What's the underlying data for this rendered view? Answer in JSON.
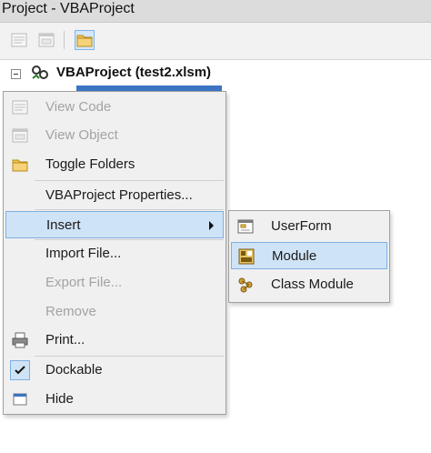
{
  "window": {
    "title": "Project - VBAProject"
  },
  "toolbar": {
    "buttons": [
      {
        "name": "view-code",
        "icon": "code-window-icon",
        "state": "disabled"
      },
      {
        "name": "view-object",
        "icon": "form-window-icon",
        "state": "disabled"
      },
      {
        "name": "toggle-folders",
        "icon": "folder-icon",
        "state": "pressed"
      }
    ]
  },
  "tree": {
    "project_label": "VBAProject (test2.xlsm)",
    "project_icon": "vba-project-icon",
    "expander_icon": "collapse-minus-icon"
  },
  "context_menu": {
    "items": [
      {
        "label": "View Code",
        "enabled": false,
        "icon": "code-window-icon"
      },
      {
        "label": "View Object",
        "enabled": false,
        "icon": "form-window-icon"
      },
      {
        "label": "Toggle Folders",
        "enabled": true,
        "icon": "folder-icon"
      },
      {
        "label": "VBAProject Properties...",
        "enabled": true,
        "icon": ""
      },
      {
        "label": "Insert",
        "enabled": true,
        "icon": "",
        "has_submenu": true,
        "highlighted": true
      },
      {
        "label": "Import File...",
        "enabled": true,
        "icon": ""
      },
      {
        "label": "Export File...",
        "enabled": false,
        "icon": ""
      },
      {
        "label": "Remove",
        "enabled": false,
        "icon": ""
      },
      {
        "label": "Print...",
        "enabled": true,
        "icon": "printer-icon"
      },
      {
        "label": "Dockable",
        "enabled": true,
        "icon": "checkmark-icon",
        "checked": true
      },
      {
        "label": "Hide",
        "enabled": true,
        "icon": "hide-window-icon"
      }
    ]
  },
  "insert_submenu": {
    "items": [
      {
        "label": "UserForm",
        "icon": "userform-icon"
      },
      {
        "label": "Module",
        "icon": "module-icon",
        "highlighted": true
      },
      {
        "label": "Class Module",
        "icon": "class-module-icon"
      }
    ]
  },
  "colors": {
    "menu_bg": "#f0f0f0",
    "highlight_bg": "#cfe3f6",
    "highlight_border": "#7fb0e0",
    "disabled_text": "#a3a3a3",
    "selection_blue": "#3b75c4"
  }
}
